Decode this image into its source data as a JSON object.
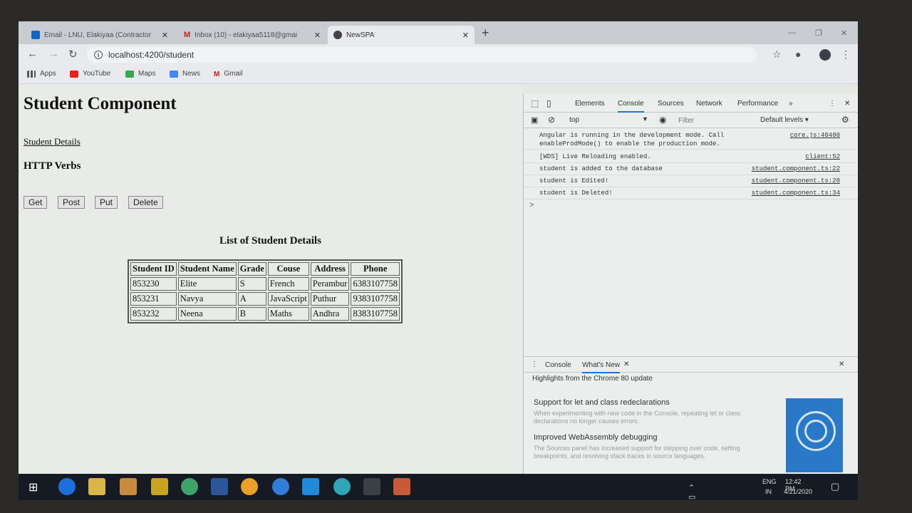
{
  "browser": {
    "tabs": [
      {
        "label": "Email - LNU, Elakiyaa (Contractor",
        "active": false
      },
      {
        "label": "Inbox (10) - elakiyaa5118@gmai",
        "active": false
      },
      {
        "label": "NewSPA",
        "active": true
      }
    ],
    "new_tab": "+",
    "url": "localhost:4200/student",
    "bookmarks": [
      "Apps",
      "YouTube",
      "Maps",
      "News",
      "Gmail"
    ]
  },
  "page": {
    "title": "Student Component",
    "link": "Student Details",
    "verbs_heading": "HTTP Verbs",
    "buttons": {
      "get": "Get",
      "post": "Post",
      "put": "Put",
      "delete": "Delete"
    },
    "list_title": "List of Student Details",
    "table": {
      "headers": [
        "Student ID",
        "Student Name",
        "Grade",
        "Couse",
        "Address",
        "Phone"
      ],
      "rows": [
        [
          "853230",
          "Elite",
          "S",
          "French",
          "Perambur",
          "6383107758"
        ],
        [
          "853231",
          "Navya",
          "A",
          "JavaScript",
          "Puthur",
          "9383107758"
        ],
        [
          "853232",
          "Neena",
          "B",
          "Maths",
          "Andhra",
          "8383107758"
        ]
      ]
    }
  },
  "devtools": {
    "tabs": [
      "Elements",
      "Console",
      "Sources",
      "Network",
      "Performance",
      "»"
    ],
    "active_tab": "Console",
    "context": "top",
    "filter_placeholder": "Filter",
    "levels": "Default levels ▾",
    "logs": [
      {
        "text": "Angular is running in the development mode. Call enableProdMode() to enable the production mode.",
        "source": "core.js:40480"
      },
      {
        "text": "[WDS] Live Reloading enabled.",
        "source": "client:52"
      },
      {
        "text": "student is added to the database",
        "source": "student.component.ts:22"
      },
      {
        "text": "student is Edited!",
        "source": "student.component.ts:28"
      },
      {
        "text": "student is Deleted!",
        "source": "student.component.ts:34"
      }
    ],
    "prompt": ">",
    "drawer": {
      "tabs": [
        "Console",
        "What's New"
      ],
      "active_tab": "What's New",
      "subtitle": "Highlights from the Chrome 80 update",
      "items": [
        {
          "title": "Support for let and class redeclarations",
          "desc": "When experimenting with new code in the Console, repeating let or class declarations no longer causes errors."
        },
        {
          "title": "Improved WebAssembly debugging",
          "desc": "The Sources panel has increased support for stepping over code, setting breakpoints, and resolving stack traces in source languages."
        }
      ]
    }
  },
  "taskbar": {
    "lang": "ENG",
    "region": "IN",
    "time": "12:42 PM",
    "date": "4/21/2020"
  }
}
